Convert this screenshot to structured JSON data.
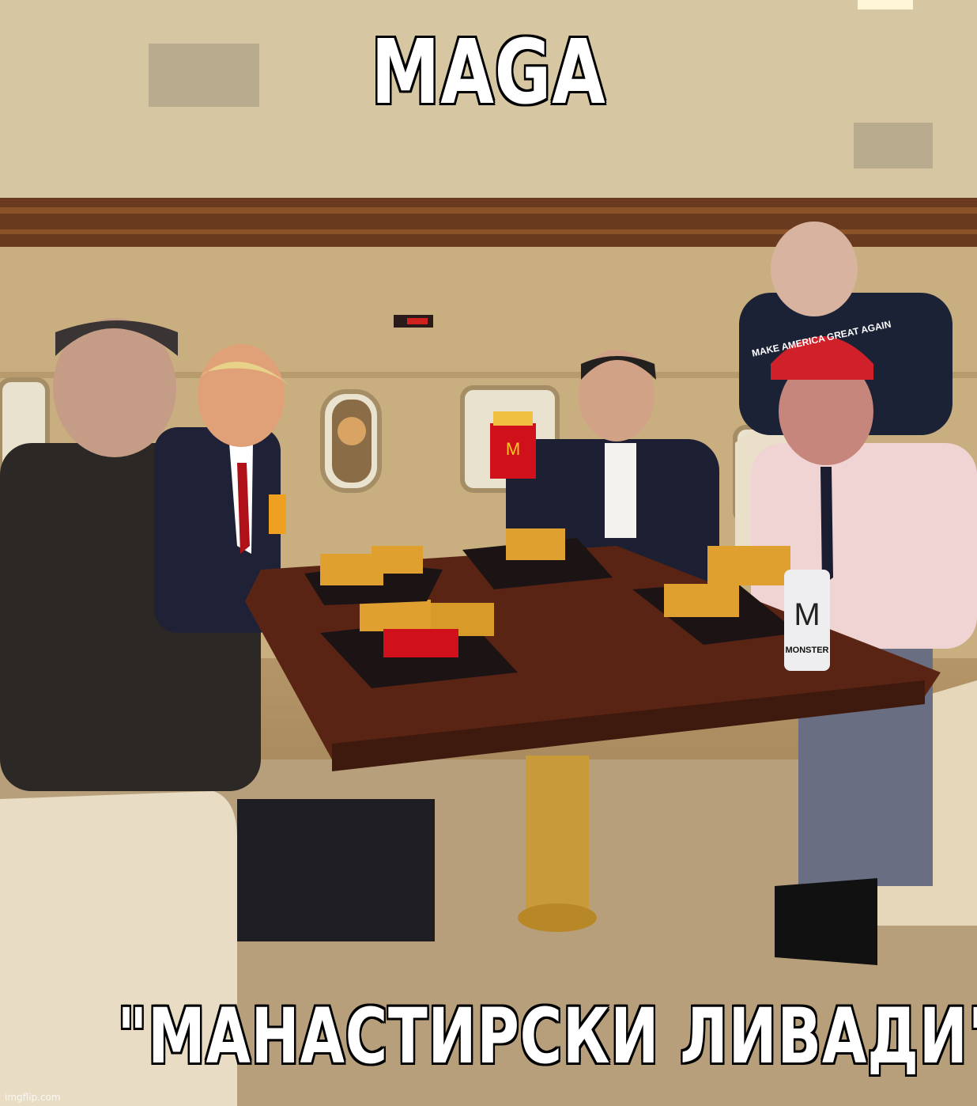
{
  "meme": {
    "top_text": "MAGA",
    "bottom_text": "\"МАНАСТИРСКИ ЛИВАДИ\"",
    "watermark": "imgflip.com"
  },
  "scene": {
    "hat_text": "MAKE AMERICA GREAT AGAIN",
    "can_text": "MONSTER"
  },
  "colors": {
    "cabin": "#cbb48c",
    "wood": "#5a2a1a",
    "hat": "#d0202a",
    "fries_box": "#d0101a",
    "burger_box": "#e0a030"
  }
}
